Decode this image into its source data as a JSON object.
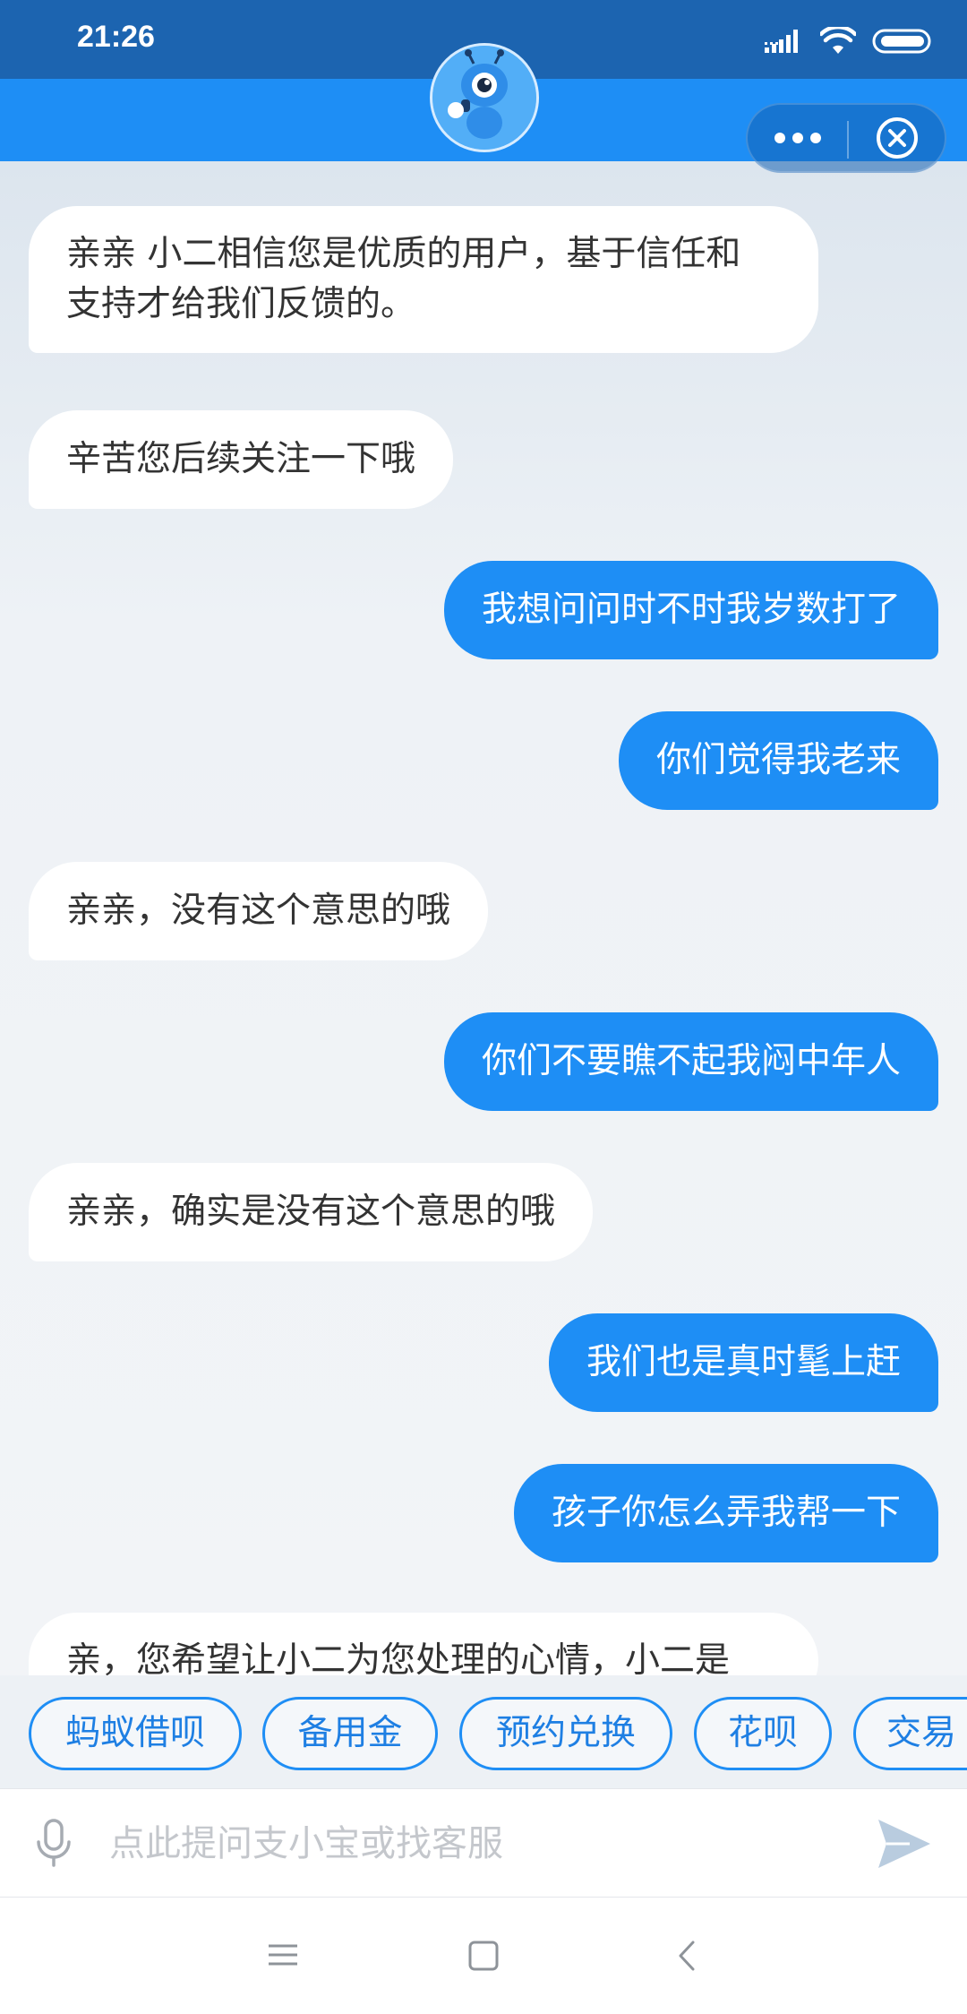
{
  "status_bar": {
    "time": "21:26",
    "icons": [
      "signal-icon",
      "wifi-icon",
      "battery-icon"
    ]
  },
  "header": {
    "avatar": "robot-mascot-avatar",
    "more_icon": "more-dots-icon",
    "close_icon": "close-circle-icon"
  },
  "messages": [
    {
      "side": "left",
      "lines": [
        "亲亲 小二相信您是优质的用户，基于信任和",
        "支持才给我们反馈的。"
      ]
    },
    {
      "side": "left",
      "lines": [
        "辛苦您后续关注一下哦"
      ]
    },
    {
      "side": "right",
      "lines": [
        "我想问问时不时我岁数打了"
      ]
    },
    {
      "side": "right",
      "lines": [
        "你们觉得我老来"
      ]
    },
    {
      "side": "left",
      "lines": [
        "亲亲，没有这个意思的哦"
      ]
    },
    {
      "side": "right",
      "lines": [
        "你们不要瞧不起我闷中年人"
      ]
    },
    {
      "side": "left",
      "lines": [
        "亲亲，确实是没有这个意思的哦"
      ]
    },
    {
      "side": "right",
      "lines": [
        "我们也是真时髦上赶"
      ]
    },
    {
      "side": "right",
      "lines": [
        "孩子你怎么弄我帮一下"
      ]
    },
    {
      "side": "left",
      "lines": [
        "亲，您希望让小二为您处理的心情，小二是"
      ]
    }
  ],
  "quick_replies": [
    "蚂蚁借呗",
    "备用金",
    "预约兑换",
    "花呗",
    "交易"
  ],
  "input": {
    "placeholder": "点此提问支小宝或找客服",
    "mic_icon": "microphone-icon",
    "send_icon": "send-icon"
  },
  "system_nav": [
    "menu-icon",
    "home-icon",
    "back-icon"
  ],
  "colors": {
    "accent": "#1e8ef5",
    "status_bar": "#1c64b0",
    "chip_text": "#1e7fe3"
  }
}
